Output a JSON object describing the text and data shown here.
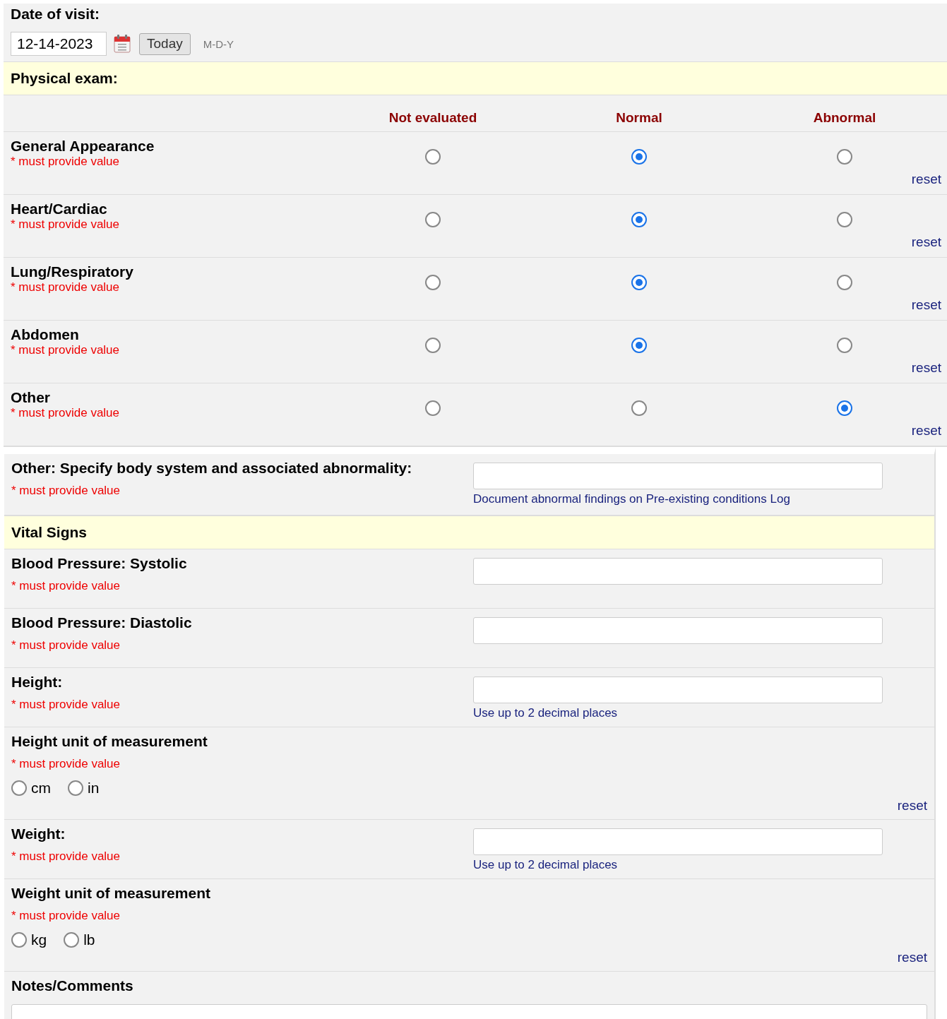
{
  "date_of_visit": {
    "label": "Date of visit:",
    "value": "12-14-2023",
    "today_button": "Today",
    "format": "M-D-Y"
  },
  "physical_exam": {
    "title": "Physical exam:",
    "columns": [
      "Not evaluated",
      "Normal",
      "Abnormal"
    ],
    "rows": [
      {
        "name": "General Appearance",
        "required": "* must provide value",
        "options": [
          {
            "selected": false
          },
          {
            "selected": true
          },
          {
            "selected": false
          }
        ],
        "reset": "reset"
      },
      {
        "name": "Heart/Cardiac",
        "required": "* must provide value",
        "options": [
          {
            "selected": false
          },
          {
            "selected": true
          },
          {
            "selected": false
          }
        ],
        "reset": "reset"
      },
      {
        "name": "Lung/Respiratory",
        "required": "* must provide value",
        "options": [
          {
            "selected": false
          },
          {
            "selected": true
          },
          {
            "selected": false
          }
        ],
        "reset": "reset"
      },
      {
        "name": "Abdomen",
        "required": "* must provide value",
        "options": [
          {
            "selected": false
          },
          {
            "selected": true
          },
          {
            "selected": false
          }
        ],
        "reset": "reset"
      },
      {
        "name": "Other",
        "required": "* must provide value",
        "options": [
          {
            "selected": false
          },
          {
            "selected": false
          },
          {
            "selected": true
          }
        ],
        "reset": "reset"
      }
    ]
  },
  "other_specify": {
    "label": "Other: Specify body system and associated abnormality:",
    "required": "* must provide value",
    "note": "Document abnormal findings on Pre-existing conditions Log"
  },
  "vital_signs": {
    "title": "Vital Signs",
    "fields": [
      {
        "kind": "text",
        "label": "Blood Pressure: Systolic",
        "required": "* must provide value"
      },
      {
        "kind": "text",
        "label": "Blood Pressure: Diastolic",
        "required": "* must provide value"
      },
      {
        "kind": "text",
        "label": "Height:",
        "required": "* must provide value",
        "note": "Use up to 2 decimal places"
      },
      {
        "kind": "radio",
        "label": "Height unit of measurement",
        "required": "* must provide value",
        "options": [
          {
            "label": "cm",
            "selected": false
          },
          {
            "label": "in",
            "selected": false
          }
        ],
        "reset": "reset"
      },
      {
        "kind": "text",
        "label": "Weight:",
        "required": "* must provide value",
        "note": "Use up to 2 decimal places"
      },
      {
        "kind": "radio",
        "label": "Weight unit of measurement",
        "required": "* must provide value",
        "options": [
          {
            "label": "kg",
            "selected": false
          },
          {
            "label": "lb",
            "selected": false
          }
        ],
        "reset": "reset"
      }
    ]
  },
  "notes": {
    "label": "Notes/Comments"
  }
}
